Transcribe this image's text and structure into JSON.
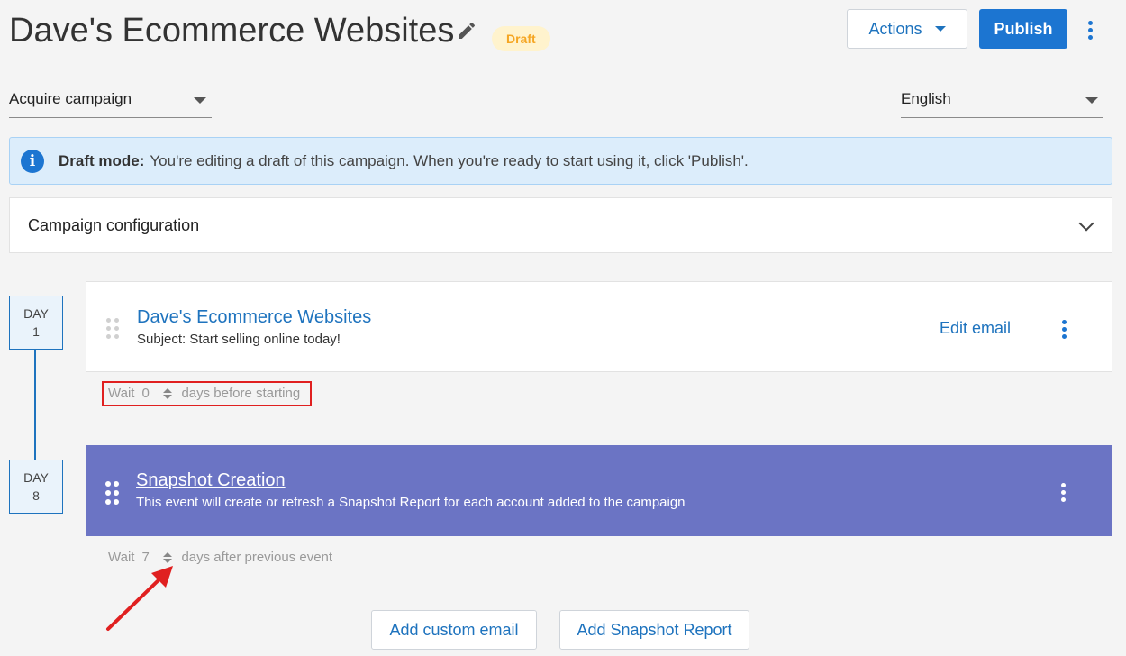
{
  "header": {
    "title": "Dave's Ecommerce Websites",
    "status_badge": "Draft",
    "actions_label": "Actions",
    "publish_label": "Publish"
  },
  "filters": {
    "campaign_type": "Acquire campaign",
    "language": "English"
  },
  "banner": {
    "bold": "Draft mode:",
    "text": "You're editing a draft of this campaign. When you're ready to start using it, click 'Publish'."
  },
  "config_section": {
    "label": "Campaign configuration"
  },
  "timeline": [
    {
      "day_label": "DAY",
      "day_number": "1",
      "title": "Dave's Ecommerce Websites",
      "subtitle": "Subject: Start selling online today!",
      "action_label": "Edit email",
      "wait": {
        "prefix": "Wait",
        "value": "0",
        "suffix": "days before starting"
      }
    },
    {
      "day_label": "DAY",
      "day_number": "8",
      "title": "Snapshot Creation",
      "subtitle": "This event will create or refresh a Snapshot Report for each account added to the campaign",
      "wait": {
        "prefix": "Wait",
        "value": "7",
        "suffix": "days after previous event"
      }
    }
  ],
  "bottom_actions": {
    "add_custom_email": "Add custom email",
    "add_snapshot_report": "Add Snapshot Report"
  },
  "colors": {
    "primary": "#1c75d1",
    "event_card": "#6b74c4",
    "draft_badge_bg": "#fff3cd",
    "draft_badge_text": "#f5a623",
    "annotation": "#e02020"
  },
  "icons": [
    "pencil-icon",
    "caret-down-icon",
    "kebab-menu-icon",
    "info-icon",
    "chevron-down-icon",
    "drag-handle-icon",
    "spinner-arrows-icon"
  ]
}
